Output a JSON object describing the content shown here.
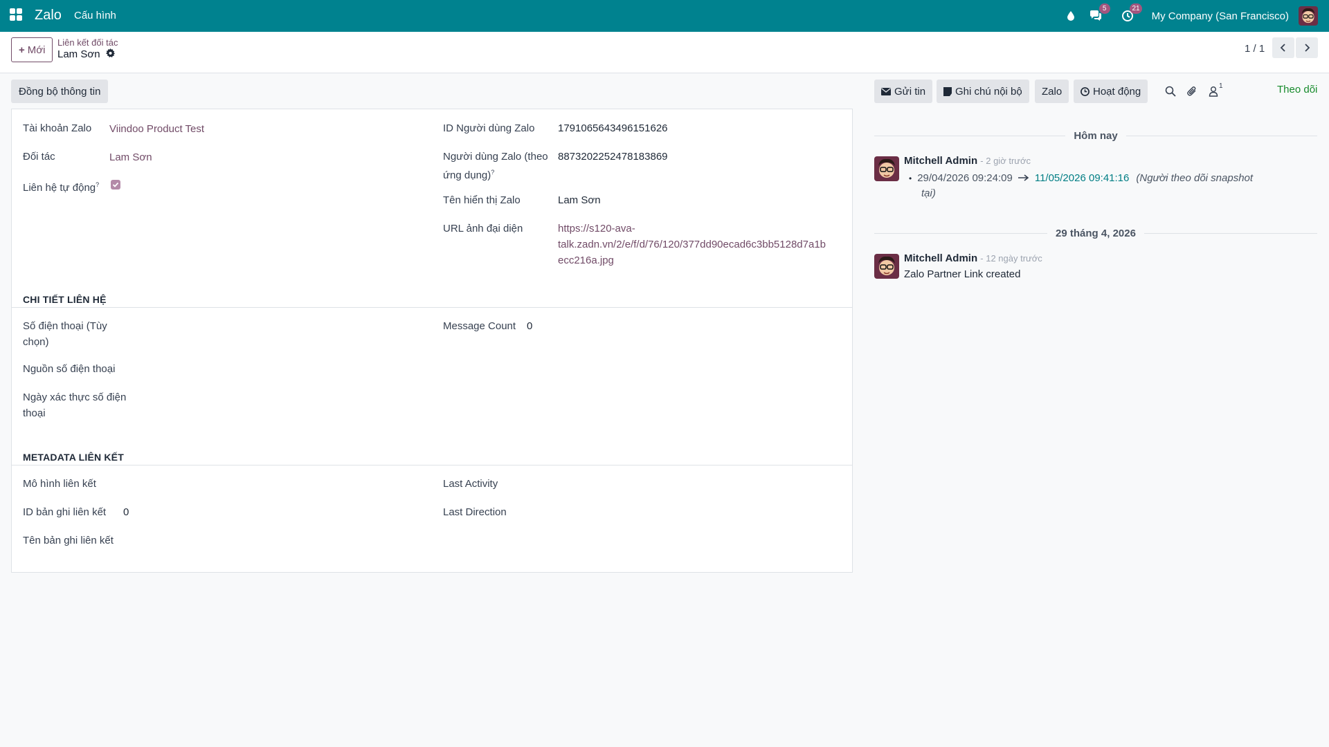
{
  "navbar": {
    "app_name": "Zalo",
    "menu_config": "Cấu hình",
    "messages_badge": "5",
    "activities_badge": "21",
    "company": "My Company (San Francisco)"
  },
  "control_panel": {
    "new_button": "Mới",
    "breadcrumb_parent": "Liên kết đối tác",
    "breadcrumb_current": "Lam Sơn",
    "pager_value": "1 / 1"
  },
  "statusbar": {
    "sync_button": "Đồng bộ thông tin"
  },
  "form": {
    "left": [
      {
        "label": "Tài khoản Zalo",
        "value": "Viindoo Product Test"
      },
      {
        "label": "Đối tác",
        "value": "Lam Sơn"
      },
      {
        "label": "Liên hệ tự động",
        "checked": true
      }
    ],
    "right": [
      {
        "label": "ID Người dùng Zalo",
        "value": "1791065643496151626"
      },
      {
        "label_line1": "Người dùng Zalo (theo",
        "label_line2": "ứng dụng)",
        "value": "8873202252478183869"
      },
      {
        "label": "Tên hiển thị Zalo",
        "value": "Lam Sơn"
      },
      {
        "label": "URL ảnh đại diện",
        "value_line1": "https://s120-ava-",
        "value_line2": "talk.zadn.vn/2/e/f/d/76/120/377dd90ecad6c3bb5128d7a1b",
        "value_line3": "ecc216a.jpg"
      }
    ],
    "tooltip_mark": "?",
    "contact_section": {
      "title": "CHI TIẾT LIÊN HỆ",
      "phone_label_line1": "Số điện thoại (Tùy",
      "phone_label_line2": "chọn)",
      "phone_source_label": "Nguồn số điện thoại",
      "verify_label_line1": "Ngày xác thực số điện",
      "verify_label_line2": "thoại",
      "message_count_label": "Message Count",
      "message_count_value": "0"
    },
    "metadata_section": {
      "title": "METADATA LIÊN KẾT",
      "model_label": "Mô hình liên kết",
      "record_id_label": "ID bản ghi liên kết",
      "record_id_value": "0",
      "record_name_label": "Tên bản ghi liên kết",
      "last_activity_label": "Last Activity",
      "last_direction_label": "Last Direction"
    }
  },
  "chatter": {
    "send_message": "Gửi tin",
    "log_note": "Ghi chú nội bộ",
    "zalo": "Zalo",
    "activity": "Hoạt động",
    "followers_count": "1",
    "follow": "Theo dõi",
    "separator_today": "Hôm nay",
    "separator_older": "29 tháng 4, 2026",
    "messages": [
      {
        "author": "Mitchell Admin",
        "time": "- 2 giờ trước",
        "old_value": "29/04/2026 09:24:09",
        "new_value": "11/05/2026 09:41:16",
        "field_line1": "(Người theo dõi snapshot",
        "field_line2": "tại)"
      },
      {
        "author": "Mitchell Admin",
        "time": "- 12 ngày trước",
        "body": "Zalo Partner Link created"
      }
    ]
  },
  "colors": {
    "navbar": "#00828f",
    "brand": "#714b67",
    "follow": "#178b2c",
    "tracking_new": "#017e84"
  }
}
